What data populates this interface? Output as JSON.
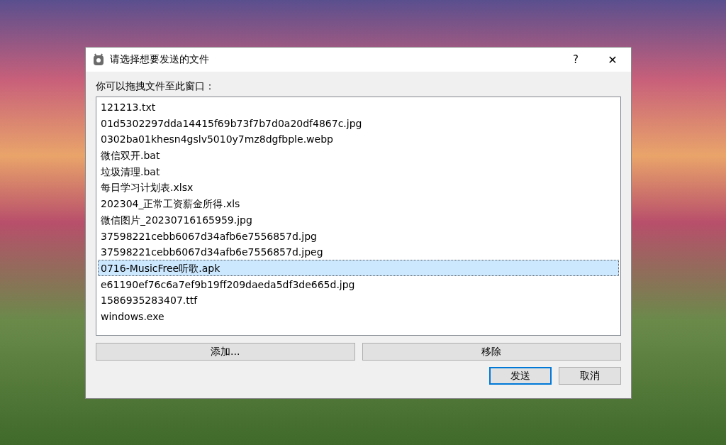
{
  "window": {
    "title": "请选择想要发送的文件",
    "help": "?",
    "close": "✕"
  },
  "instruction": "你可以拖拽文件至此窗口：",
  "files": [
    {
      "name": "121213.txt",
      "selected": false
    },
    {
      "name": "01d5302297dda14415f69b73f7b7d0a20df4867c.jpg",
      "selected": false
    },
    {
      "name": "0302ba01khesn4gslv5010y7mz8dgfbple.webp",
      "selected": false
    },
    {
      "name": "微信双开.bat",
      "selected": false
    },
    {
      "name": "垃圾清理.bat",
      "selected": false
    },
    {
      "name": "每日学习计划表.xlsx",
      "selected": false
    },
    {
      "name": "202304_正常工资薪金所得.xls",
      "selected": false
    },
    {
      "name": "微信图片_20230716165959.jpg",
      "selected": false
    },
    {
      "name": "37598221cebb6067d34afb6e7556857d.jpg",
      "selected": false
    },
    {
      "name": "37598221cebb6067d34afb6e7556857d.jpeg",
      "selected": false
    },
    {
      "name": "0716-MusicFree听歌.apk",
      "selected": true
    },
    {
      "name": "e61190ef76c6a7ef9b19ff209daeda5df3de665d.jpg",
      "selected": false
    },
    {
      "name": "1586935283407.ttf",
      "selected": false
    },
    {
      "name": "windows.exe",
      "selected": false
    }
  ],
  "list_buttons": [
    "添加...",
    "移除"
  ],
  "dialog_buttons": [
    {
      "label": "发送",
      "default": true
    },
    {
      "label": "取消",
      "default": false
    }
  ]
}
